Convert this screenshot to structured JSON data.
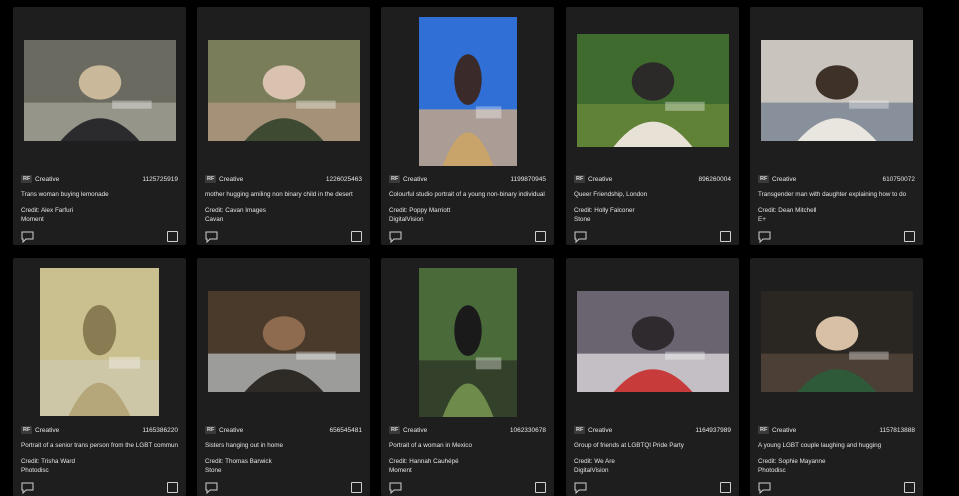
{
  "results": [
    {
      "license": "RF",
      "type": "Creative",
      "id": "1125725919",
      "caption": "Trans woman buying lemonade",
      "credit": "Credit: Alex Farfuri",
      "collection": "Moment",
      "thumb_icon": "photo-woman-street"
    },
    {
      "license": "RF",
      "type": "Creative",
      "id": "1226025463",
      "caption": "mother hugging amiling non binary child in the desert",
      "credit": "Credit: Cavan Images",
      "collection": "Cavan",
      "thumb_icon": "photo-mother-child-desert"
    },
    {
      "license": "RF",
      "type": "Creative",
      "id": "1199870945",
      "caption": "Colourful studio portrait of a young non-binary individual",
      "credit": "Credit: Poppy Marriott",
      "collection": "DigitalVision",
      "thumb_icon": "photo-portrait-blue-background"
    },
    {
      "license": "RF",
      "type": "Creative",
      "id": "896260004",
      "caption": "Queer Friendship, London",
      "credit": "Credit: Holly Falconer",
      "collection": "Stone",
      "thumb_icon": "photo-friends-lying-grass"
    },
    {
      "license": "RF",
      "type": "Creative",
      "id": "610750072",
      "caption": "Transgender man with daughter explaining how to do",
      "credit": "Credit: Dean Mitchell",
      "collection": "E+",
      "thumb_icon": "photo-man-daughter-sofa"
    },
    {
      "license": "RF",
      "type": "Creative",
      "id": "1165386220",
      "caption": "Portrait of a senior trans person from the LGBT community",
      "credit": "Credit: Trisha Ward",
      "collection": "Photodisc",
      "thumb_icon": "photo-senior-portrait"
    },
    {
      "license": "RF",
      "type": "Creative",
      "id": "656545481",
      "caption": "Sisters hanging out in home",
      "credit": "Credit: Thomas Barwick",
      "collection": "Stone",
      "thumb_icon": "photo-sisters-home-interior"
    },
    {
      "license": "RF",
      "type": "Creative",
      "id": "1062330678",
      "caption": "Portrait of a woman in Mexico",
      "credit": "Credit: Hannah Cauhépé",
      "collection": "Moment",
      "thumb_icon": "photo-woman-curly-hair"
    },
    {
      "license": "RF",
      "type": "Creative",
      "id": "1164937989",
      "caption": "Group of friends at LGBTQI Pride Party",
      "credit": "Credit: We Are",
      "collection": "DigitalVision",
      "thumb_icon": "photo-friends-pride-party"
    },
    {
      "license": "RF",
      "type": "Creative",
      "id": "1157813888",
      "caption": "A young LGBT couple laughing and hugging",
      "credit": "Credit: Sophie Mayanne",
      "collection": "Photodisc",
      "thumb_icon": "photo-couple-hugging"
    }
  ],
  "icons": {
    "comment": "comment-icon",
    "select": "checkbox"
  },
  "colors": {
    "background": "#000000",
    "card": "#1e1e1e",
    "text": "#e6e6e6"
  }
}
